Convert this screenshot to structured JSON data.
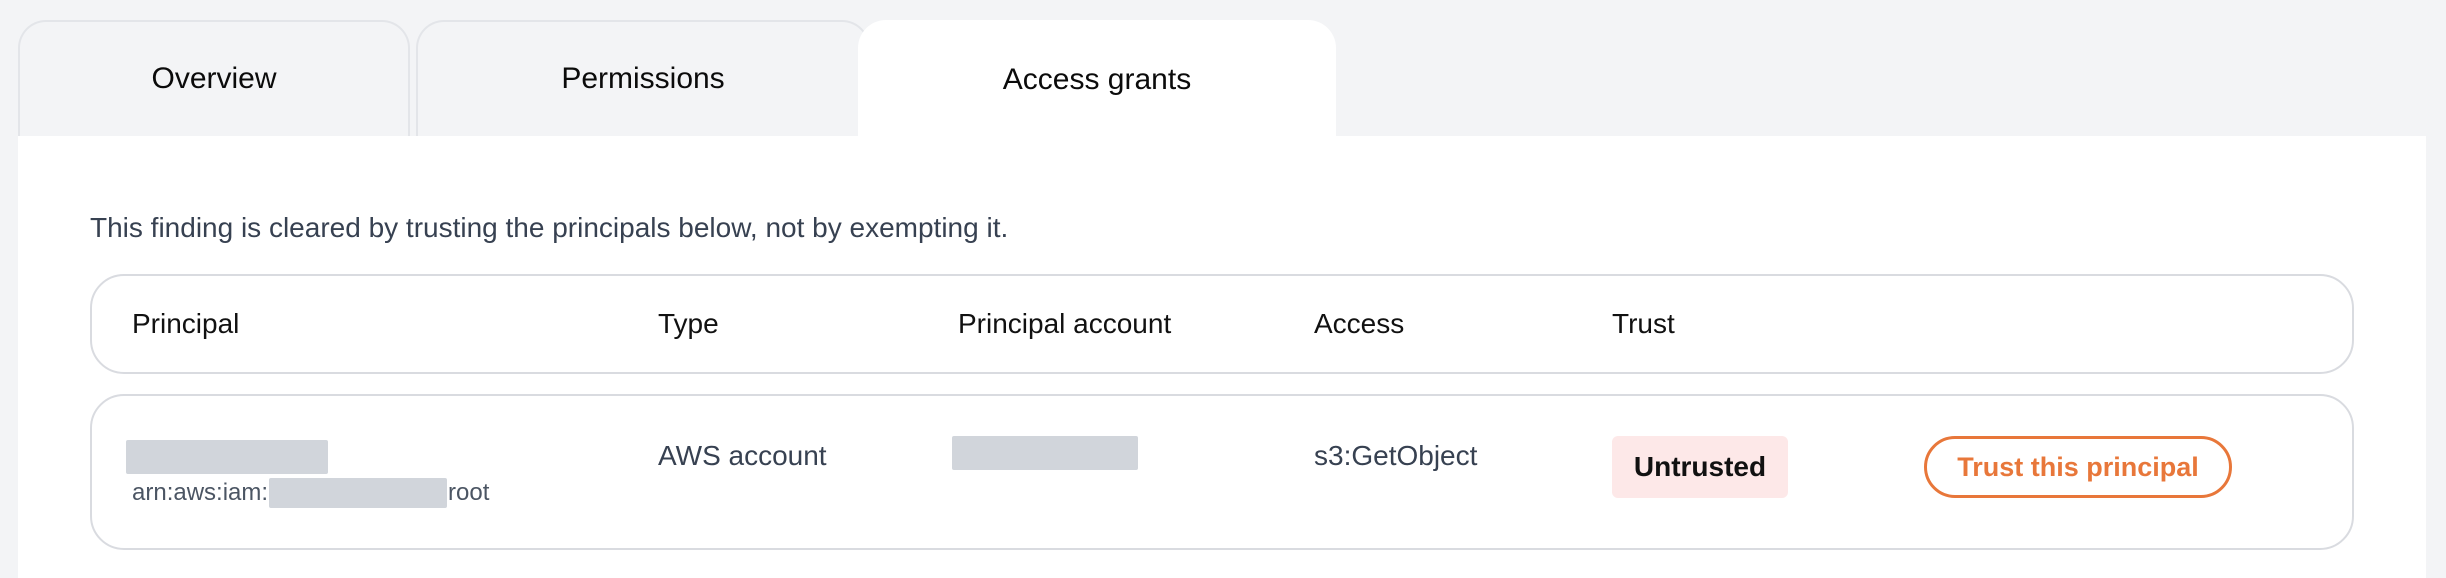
{
  "tabs": [
    {
      "label": "Overview"
    },
    {
      "label": "Permissions"
    },
    {
      "label": "Access grants"
    }
  ],
  "active_tab": "Access grants",
  "panel": {
    "intro": "This finding is cleared by trusting the principals below, not by exempting it.",
    "columns": [
      "Principal",
      "Type",
      "Principal account",
      "Access",
      "Trust"
    ],
    "rows": [
      {
        "principal_name": "",
        "arn_prefix": "arn:aws:iam:",
        "arn_suffix": "root",
        "type": "AWS account",
        "principal_account": "",
        "access": "s3:GetObject",
        "trust_status": "Untrusted",
        "action_label": "Trust this principal"
      }
    ]
  },
  "colors": {
    "accent": "#e8773a",
    "badge_bg": "#fde8e8",
    "redaction": "#d1d5db",
    "page_bg": "#f3f4f6"
  }
}
